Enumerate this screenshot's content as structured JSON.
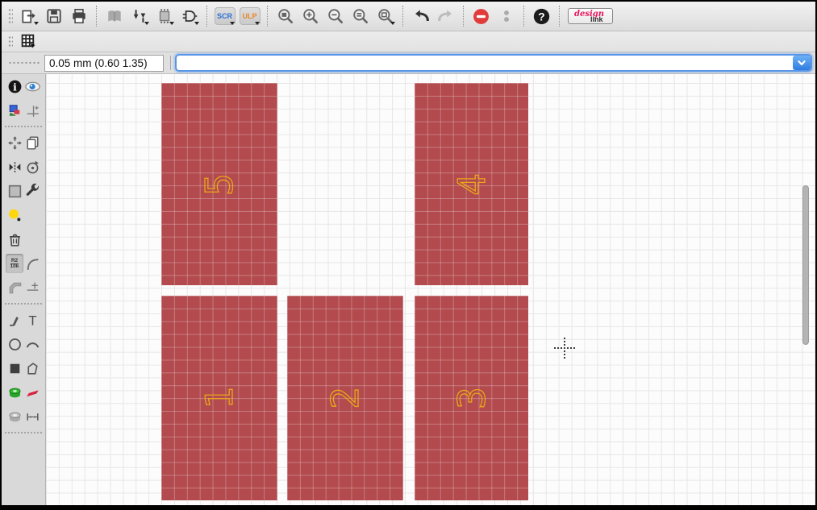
{
  "toolbar_main": {
    "file_group": [
      {
        "icon": "open-icon",
        "has_dropdown": true
      },
      {
        "icon": "save-icon",
        "has_dropdown": false
      },
      {
        "icon": "print-icon",
        "has_dropdown": false
      }
    ],
    "library_group": [
      {
        "icon": "library-book-icon",
        "has_dropdown": false,
        "disabled": true
      },
      {
        "icon": "pinswap-icon",
        "has_dropdown": true
      },
      {
        "icon": "replace-ic-icon",
        "has_dropdown": true
      },
      {
        "icon": "gateswap-icon",
        "has_dropdown": true
      }
    ],
    "script_group": [
      {
        "icon": "scr-script-icon",
        "label": "SCR",
        "label_color": "#2a6fd6",
        "has_dropdown": true
      },
      {
        "icon": "ulp-icon",
        "label": "ULP",
        "label_color": "#e8872a",
        "has_dropdown": true
      }
    ],
    "zoom_group": [
      {
        "icon": "zoom-fit-icon"
      },
      {
        "icon": "zoom-in-icon"
      },
      {
        "icon": "zoom-out-icon"
      },
      {
        "icon": "zoom-redraw-icon"
      },
      {
        "icon": "zoom-select-icon",
        "has_dropdown": true
      }
    ],
    "edit_group": [
      {
        "icon": "undo-icon",
        "disabled": false
      },
      {
        "icon": "redo-icon",
        "disabled": true
      }
    ],
    "run_group": [
      {
        "icon": "stop-icon",
        "disabled": false
      },
      {
        "icon": "traffic-light-icon",
        "disabled": true
      }
    ],
    "help_group": [
      {
        "icon": "help-icon"
      }
    ],
    "design_link_button": {
      "word1": "design",
      "word2": "link"
    }
  },
  "toolbar_secondary": {
    "grid_button_icon": "grid-icon"
  },
  "parameter_bar": {
    "coordinate_display": "0.05 mm (0.60 1.35)",
    "command_input": {
      "value": "",
      "placeholder": ""
    }
  },
  "sidebar": {
    "active_tool": "name-value-tool",
    "name_tool_label": {
      "line1": "R2",
      "line2": "10k"
    },
    "tools": [
      "info-icon",
      "show-eye-icon",
      "display-layers-icon",
      "mark-icon",
      "move-icon",
      "copy-icon",
      "mirror-icon",
      "rotate-icon",
      "group-icon",
      "change-wrench-icon",
      "smash-icon",
      "delete-trash-icon",
      "name-value-icon",
      "miter-icon",
      "split-icon",
      "optimize-icon",
      "wire-icon",
      "text-icon",
      "circle-icon",
      "arc-icon",
      "rect-icon",
      "polygon-icon",
      "pad-icon",
      "smd-icon",
      "hole-icon",
      "measure-icon"
    ]
  },
  "glyphs": {
    "text_tool": "T",
    "help": "?",
    "info": "i"
  },
  "canvas": {
    "boards": [
      {
        "label": "5"
      },
      {
        "label": "4"
      },
      {
        "label": "1"
      },
      {
        "label": "2"
      },
      {
        "label": "3"
      }
    ],
    "board_fill": "#b24a4e",
    "board_label_color": "#eaa819",
    "grid_line_color": "#e7e7e7",
    "accent_blue": "#3a8de8"
  }
}
